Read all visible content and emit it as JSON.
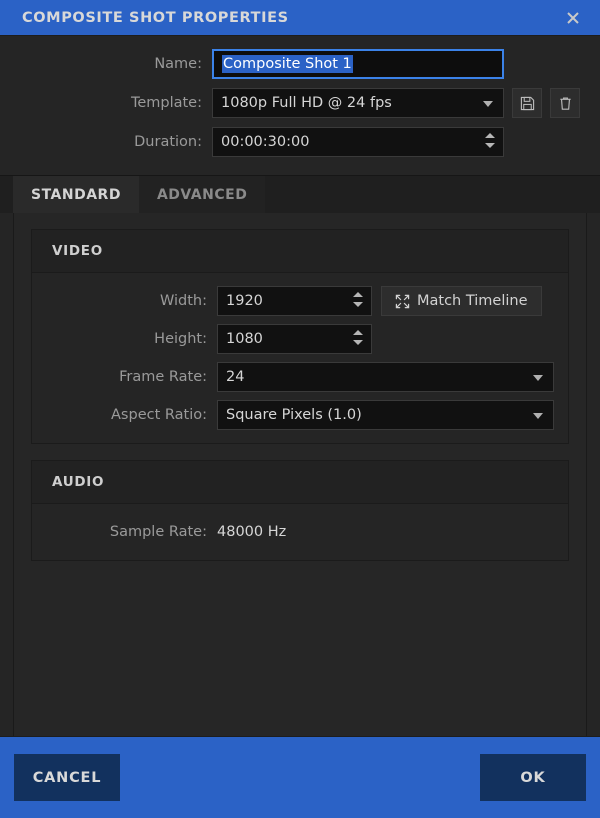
{
  "window": {
    "title": "COMPOSITE SHOT PROPERTIES",
    "close_icon": "close-icon",
    "accent_color": "#2b62c6",
    "background_color": "#252525"
  },
  "topform": {
    "name": {
      "label": "Name:",
      "value": "Composite Shot 1",
      "focused": true,
      "selected": true
    },
    "template": {
      "label": "Template:",
      "value": "1080p Full HD @ 24 fps",
      "save_icon": "floppy-disk-save-icon",
      "delete_icon": "trash-delete-icon"
    },
    "duration": {
      "label": "Duration:",
      "value": "00:00:30:00"
    }
  },
  "tabs": [
    {
      "label": "STANDARD",
      "active": true
    },
    {
      "label": "ADVANCED",
      "active": false
    }
  ],
  "sections": {
    "video": {
      "title": "VIDEO",
      "width": {
        "label": "Width:",
        "value": "1920"
      },
      "height": {
        "label": "Height:",
        "value": "1080"
      },
      "frame_rate": {
        "label": "Frame Rate:",
        "value": "24"
      },
      "aspect_ratio": {
        "label": "Aspect Ratio:",
        "value": "Square Pixels (1.0)"
      },
      "match_timeline": {
        "label": "Match Timeline",
        "icon": "expand-arrows-icon"
      }
    },
    "audio": {
      "title": "AUDIO",
      "sample_rate": {
        "label": "Sample Rate:",
        "value": "48000 Hz"
      }
    }
  },
  "footer": {
    "cancel_label": "CANCEL",
    "ok_label": "OK"
  }
}
